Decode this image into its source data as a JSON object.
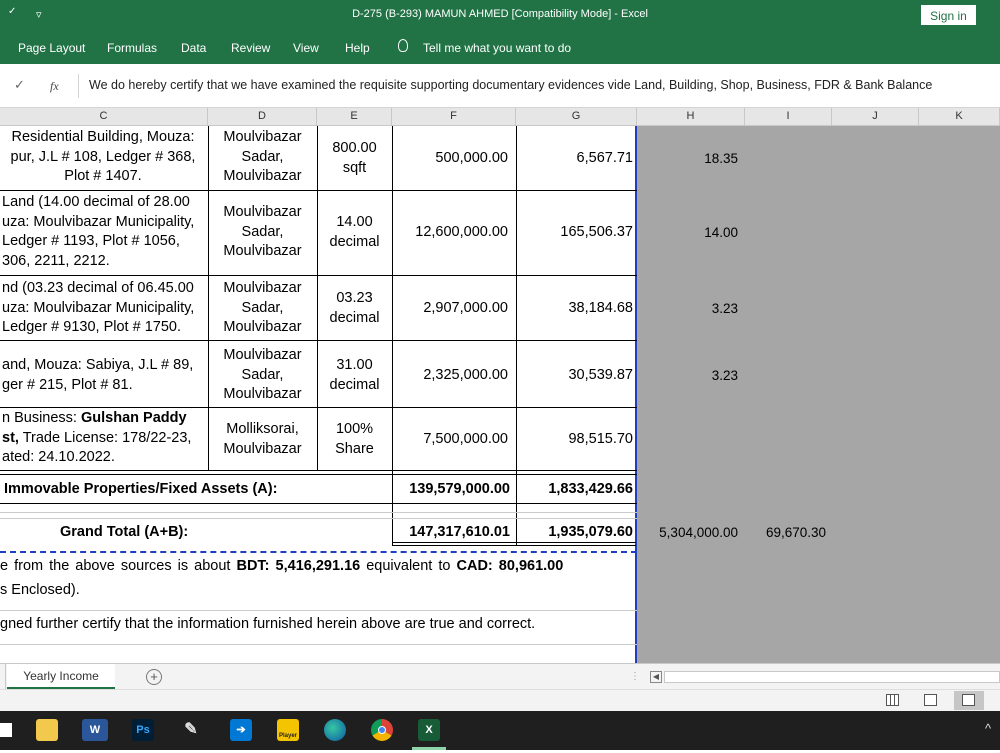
{
  "window": {
    "title": "D-275 (B-293) MAMUN AHMED  [Compatibility Mode]  -  Excel",
    "sign_in": "Sign in"
  },
  "ribbon": {
    "tabs": [
      "Page Layout",
      "Formulas",
      "Data",
      "Review",
      "View",
      "Help"
    ],
    "tell_me": "Tell me what you want to do"
  },
  "formula_bar": {
    "fx": "fx",
    "text": "We do hereby certify that we have examined the requisite supporting documentary evidences vide Land, Building, Shop, Business, FDR & Bank Balance"
  },
  "columns": [
    "C",
    "D",
    "E",
    "F",
    "G",
    "H",
    "I",
    "J",
    "K"
  ],
  "rows": [
    {
      "c": [
        "Residential Building, Mouza:",
        "pur, J.L # 108, Ledger # 368,",
        "Plot # 1407."
      ],
      "d": [
        "Moulvibazar",
        "Sadar,",
        "Moulvibazar"
      ],
      "e": [
        "800.00",
        "sqft"
      ],
      "f": "500,000.00",
      "g": "6,567.71",
      "h": "18.35"
    },
    {
      "c": [
        "Land (14.00 decimal of 28.00",
        "uza: Moulvibazar Municipality,",
        "Ledger # 1193, Plot # 1056,",
        "306, 2211, 2212."
      ],
      "d": [
        "Moulvibazar",
        "Sadar,",
        "Moulvibazar"
      ],
      "e": [
        "14.00",
        "decimal"
      ],
      "f": "12,600,000.00",
      "g": "165,506.37",
      "h": "14.00"
    },
    {
      "c": [
        "nd (03.23 decimal of 06.45.00",
        "uza: Moulvibazar Municipality,",
        "Ledger # 9130, Plot # 1750."
      ],
      "d": [
        "Moulvibazar",
        "Sadar,",
        "Moulvibazar"
      ],
      "e": [
        "03.23",
        "decimal"
      ],
      "f": "2,907,000.00",
      "g": "38,184.68",
      "h": "3.23"
    },
    {
      "c": [
        "and, Mouza: Sabiya, J.L # 89,",
        "ger # 215, Plot # 81."
      ],
      "d": [
        "Moulvibazar",
        "Sadar,",
        "Moulvibazar"
      ],
      "e": [
        "31.00",
        "decimal"
      ],
      "f": "2,325,000.00",
      "g": "30,539.87",
      "h": "3.23"
    },
    {
      "c_plain_1": "n Business: ",
      "c_bold_1": "Gulshan Paddy",
      "c_bold_2": "st,",
      "c_plain_2": " Trade License: 178/22-23,",
      "c_line3": "ated: 24.10.2022.",
      "d": [
        "Molliksorai,",
        "Moulvibazar"
      ],
      "e": [
        "100%",
        "Share"
      ],
      "f": "7,500,000.00",
      "g": "98,515.70"
    }
  ],
  "subtotal": {
    "label": "Immovable Properties/Fixed Assets (A):",
    "f": "139,579,000.00",
    "g": "1,833,429.66"
  },
  "grand_total": {
    "label": "Grand Total (A+B):",
    "f": "147,317,610.01",
    "g": "1,935,079.60",
    "h": "5,304,000.00",
    "i": "69,670.30"
  },
  "income_note": {
    "pre": "e from the above sources is about ",
    "bdt_label": "BDT: ",
    "bdt_value": "5,416,291.16",
    "mid": " equivalent to ",
    "cad_label": "CAD: ",
    "cad_value": "80,961.00",
    "line2": "s Enclosed)."
  },
  "certify_line": "gned further certify that the information furnished herein above are true and correct.",
  "sheet_tab": "Yearly Income",
  "add_sheet": "+",
  "taskbar": {
    "word": "W",
    "ps": "Ps",
    "excel": "X",
    "player": "Player"
  },
  "accent": "#217346"
}
